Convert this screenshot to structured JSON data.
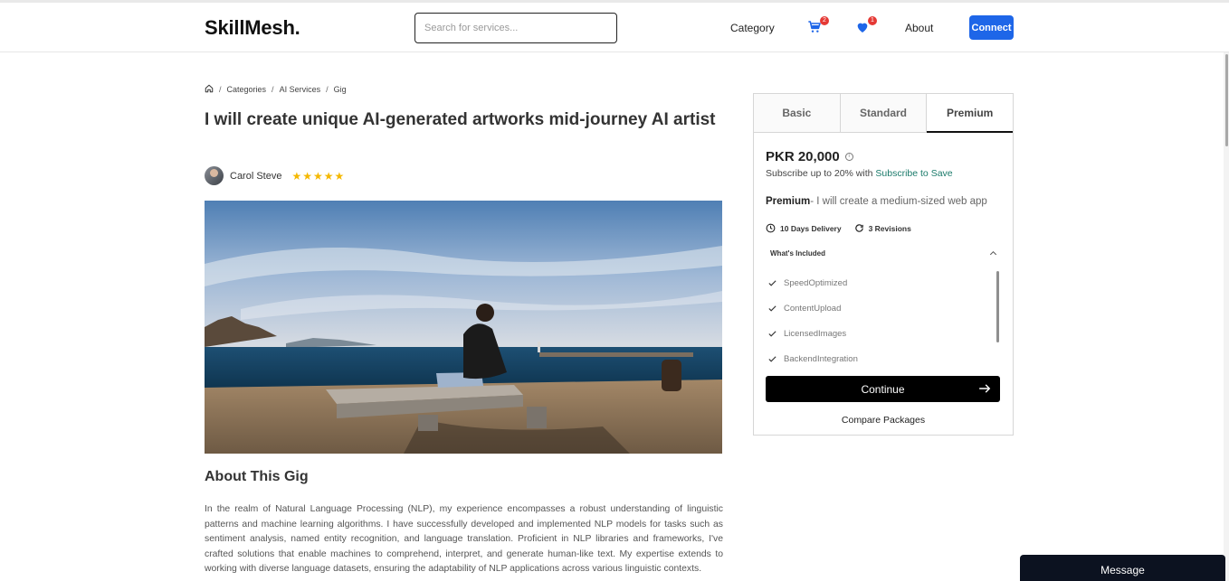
{
  "header": {
    "logo": "SkillMesh.",
    "search_placeholder": "Search for services...",
    "category_label": "Category",
    "cart_count": "2",
    "wishlist_count": "1",
    "about_label": "About",
    "connect_label": "Connect"
  },
  "breadcrumb": {
    "items": [
      "Categories",
      "AI Services",
      "Gig"
    ],
    "separator": "/"
  },
  "gig": {
    "title": "I will create unique AI-generated artworks mid-journey AI artist",
    "seller_name": "Carol Steve",
    "rating_stars": "★★★★★",
    "rating": 5
  },
  "about": {
    "heading": "About This Gig",
    "text": "In the realm of Natural Language Processing (NLP), my experience encompasses a robust understanding of linguistic patterns and machine learning algorithms. I have successfully developed and implemented NLP models for tasks such as sentiment analysis, named entity recognition, and language translation. Proficient in NLP libraries and frameworks, I've crafted solutions that enable machines to comprehend, interpret, and generate human-like text. My expertise extends to working with diverse language datasets, ensuring the adaptability of NLP applications across various linguistic contexts."
  },
  "package": {
    "tabs": [
      "Basic",
      "Standard",
      "Premium"
    ],
    "active_tab": "Premium",
    "price": "PKR  20,000",
    "subscribe_prefix": "Subscribe up to 20% with",
    "subscribe_link": "Subscribe to Save",
    "name": "Premium",
    "description": "- I will create a medium-sized web app",
    "delivery": "10 Days Delivery",
    "revisions": "3 Revisions",
    "included_heading": "What's Included",
    "included": [
      "SpeedOptimized",
      "ContentUpload",
      "LicensedImages",
      "BackendIntegration"
    ],
    "continue_label": "Continue",
    "compare_label": "Compare Packages"
  },
  "chat": {
    "message_label": "Message"
  },
  "colors": {
    "accent": "#1e66e8",
    "star": "#f5b800",
    "link": "#1a7a6a",
    "dark": "#0c1220"
  }
}
